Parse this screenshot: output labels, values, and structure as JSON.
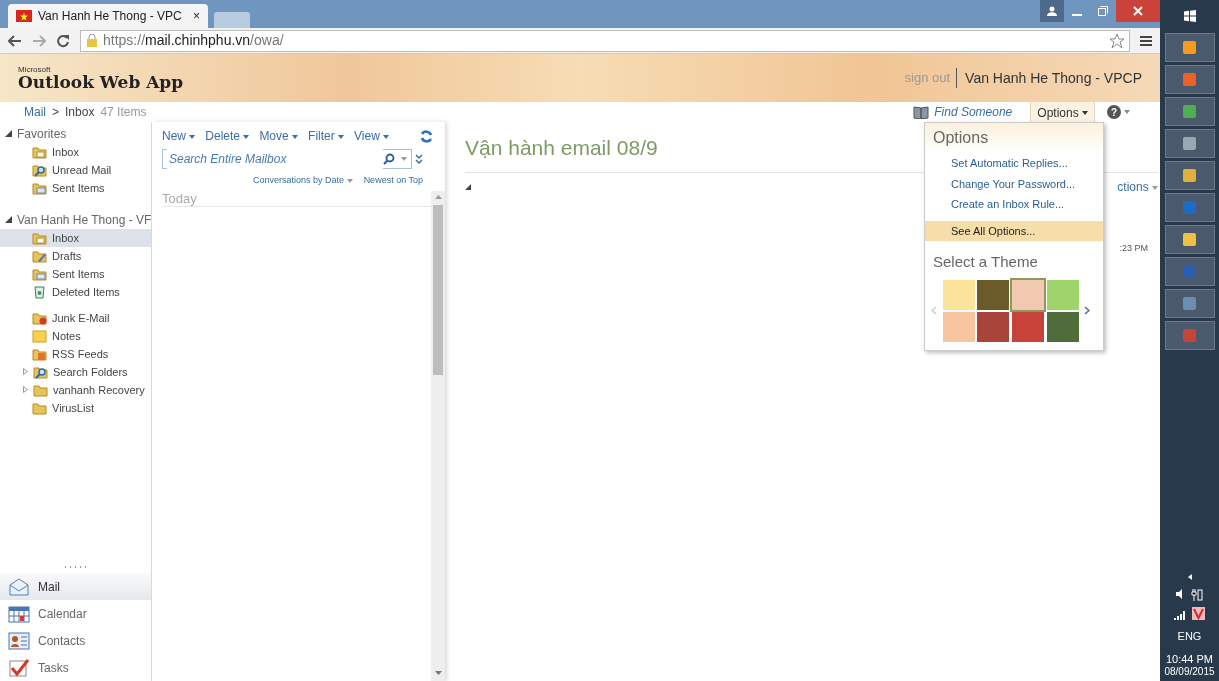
{
  "browser": {
    "tab": {
      "title": "Van Hanh He Thong - VPC",
      "close": "×"
    },
    "url": {
      "scheme": "https://",
      "host": "mail.chinhphu.vn",
      "path": "/owa/"
    }
  },
  "header": {
    "logo_small": "Microsoft",
    "logo": "Outlook Web App",
    "sign_out": "sign out",
    "user": "Van Hanh He Thong - VPCP"
  },
  "breadcrumb": {
    "root": "Mail",
    "separator": ">",
    "folder": "Inbox",
    "count": "47 Items"
  },
  "top_links": {
    "find": "Find Someone",
    "options": "Options",
    "help": "?"
  },
  "toolbar": [
    "New",
    "Delete",
    "Move",
    "Filter",
    "View"
  ],
  "search": {
    "placeholder": "Search Entire Mailbox"
  },
  "sort": {
    "arrange": "Conversations by Date",
    "order": "Newest on Top"
  },
  "group_header": "Today",
  "folders": [
    {
      "label": "Favorites",
      "expanded": true,
      "children": [
        {
          "label": "Inbox",
          "kind": "inbox",
          "selected": false
        },
        {
          "label": "Unread Mail",
          "kind": "search",
          "selected": false
        },
        {
          "label": "Sent Items",
          "kind": "sent",
          "selected": false
        }
      ]
    },
    {
      "label": "Van Hanh He Thong - VF",
      "expanded": true,
      "children": [
        {
          "label": "Inbox",
          "kind": "inbox",
          "selected": true
        },
        {
          "label": "Drafts",
          "kind": "drafts",
          "selected": false
        },
        {
          "label": "Sent Items",
          "kind": "sent",
          "selected": false
        },
        {
          "label": "Deleted Items",
          "kind": "deleted",
          "selected": false
        },
        {
          "label": "Junk E-Mail",
          "kind": "junk",
          "selected": false,
          "gap": true
        },
        {
          "label": "Notes",
          "kind": "notes",
          "selected": false
        },
        {
          "label": "RSS Feeds",
          "kind": "rss",
          "selected": false
        },
        {
          "label": "Search Folders",
          "kind": "search",
          "selected": false,
          "expanded": false
        },
        {
          "label": "vanhanh Recovery",
          "kind": "folder",
          "selected": false,
          "expanded": false
        },
        {
          "label": "VirusList",
          "kind": "folder",
          "selected": false
        }
      ]
    }
  ],
  "modules": [
    {
      "label": "Mail",
      "kind": "mail",
      "selected": true
    },
    {
      "label": "Calendar",
      "kind": "calendar",
      "selected": false
    },
    {
      "label": "Contacts",
      "kind": "contacts",
      "selected": false
    },
    {
      "label": "Tasks",
      "kind": "tasks",
      "selected": false
    }
  ],
  "reading": {
    "subject": "Vận hành email 08/9",
    "actions": "ctions",
    "time": ":23 PM"
  },
  "options_menu": {
    "title": "Options",
    "items": [
      {
        "label": "Set Automatic Replies...",
        "selected": false
      },
      {
        "label": "Change Your Password...",
        "selected": false
      },
      {
        "label": "Create an Inbox Rule...",
        "selected": false
      },
      {
        "label": "See All Options...",
        "selected": true
      }
    ],
    "theme_title": "Select a Theme",
    "themes": [
      {
        "color": "#fbe49a",
        "selected": false
      },
      {
        "color": "#6b5a2a",
        "selected": false
      },
      {
        "color": "#f2c9b0",
        "selected": true
      },
      {
        "color": "#9fd46a",
        "selected": false
      },
      {
        "color": "#f7c4a0",
        "selected": false
      },
      {
        "color": "#a8443a",
        "selected": false
      },
      {
        "color": "#c8423a",
        "selected": false
      },
      {
        "color": "#4f6d3a",
        "selected": false
      }
    ]
  },
  "taskbar": {
    "apps": [
      {
        "color": "#f39c21"
      },
      {
        "color": "#e8622a"
      },
      {
        "color": "#4caf50"
      },
      {
        "color": "#9aa7b5"
      },
      {
        "color": "#e0b03c"
      },
      {
        "color": "#1a6cc4"
      },
      {
        "color": "#f0c240"
      },
      {
        "color": "#2b5fad"
      },
      {
        "color": "#6a8fb0"
      },
      {
        "color": "#c8433a"
      }
    ],
    "tray": {
      "language": "ENG",
      "time": "10:44 PM",
      "date": "08/09/2015"
    }
  }
}
